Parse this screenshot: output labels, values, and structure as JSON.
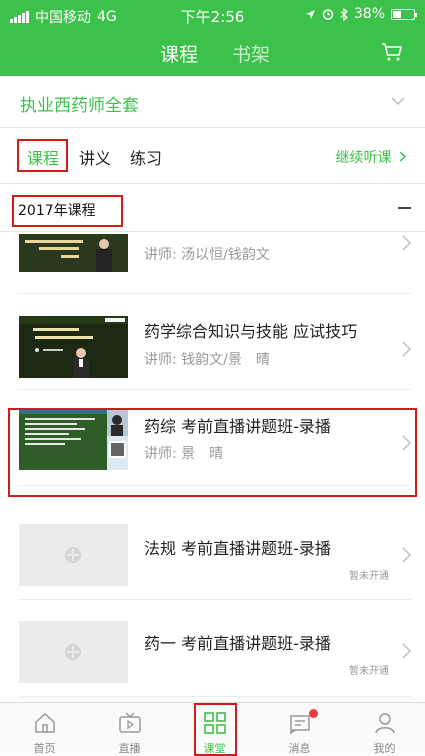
{
  "status_bar": {
    "carrier": "中国移动",
    "network": "4G",
    "time": "下午2:56",
    "battery": "38%",
    "battery_level": 0.38
  },
  "top_tabs": [
    "课程",
    "书架"
  ],
  "course_selector": {
    "title": "执业西药师全套"
  },
  "content_tabs": {
    "items": [
      "课程",
      "讲义",
      "练习"
    ],
    "active": 0,
    "continue_label": "继续听课"
  },
  "section": {
    "label": "2017年课程"
  },
  "courses": [
    {
      "name": "",
      "teacher_label": "讲师:",
      "teacher": "汤以恒/钱韵文",
      "status": "",
      "thumb": "video"
    },
    {
      "name": "药学综合知识与技能 应试技巧",
      "teacher_label": "讲师:",
      "teacher": "钱韵文/景　晴",
      "status": "",
      "thumb": "video"
    },
    {
      "name": "药综 考前直播讲题班-录播",
      "teacher_label": "讲师:",
      "teacher": "景　晴",
      "status": "",
      "thumb": "live"
    },
    {
      "name": "法规 考前直播讲题班-录播",
      "teacher_label": "",
      "teacher": "",
      "status": "暂未开通",
      "thumb": "placeholder"
    },
    {
      "name": "药一 考前直播讲题班-录播",
      "teacher_label": "",
      "teacher": "",
      "status": "暂未开通",
      "thumb": "placeholder"
    }
  ],
  "tab_bar": [
    {
      "label": "首页",
      "icon": "home-icon"
    },
    {
      "label": "直播",
      "icon": "tv-icon"
    },
    {
      "label": "课堂",
      "icon": "grid-icon"
    },
    {
      "label": "消息",
      "icon": "message-icon"
    },
    {
      "label": "我的",
      "icon": "user-icon"
    }
  ],
  "colors": {
    "accent": "#3cc24a",
    "highlight": "#d51a1a",
    "badge": "#ee3b3b"
  }
}
